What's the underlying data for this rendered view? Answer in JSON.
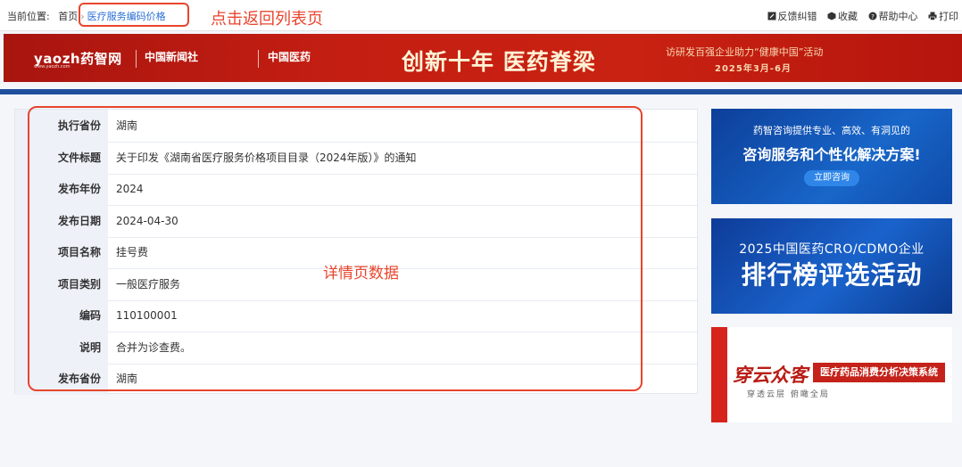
{
  "breadcrumb": {
    "prefix": "当前位置:",
    "home": "首页",
    "separator": "›",
    "current": "医疗服务编码价格"
  },
  "annotations": {
    "back_hint": "点击返回列表页",
    "detail_hint": "详情页数据",
    "color": "#e8452d"
  },
  "tools": {
    "feedback": "反馈纠错",
    "favorite": "收藏",
    "help": "帮助中心",
    "print": "打印"
  },
  "banner": {
    "logo": "yaozh药智网",
    "logo_sub": "www.yaozh.com",
    "partner1": "中国新闻社",
    "partner2": "中国医药",
    "headline": "创新十年 医药脊梁",
    "event": "访研发百强企业助力“健康中国”活动",
    "date": "2025年3月-6月"
  },
  "detail": {
    "rows": [
      {
        "label": "执行省份",
        "value": "湖南"
      },
      {
        "label": "文件标题",
        "value": "关于印发《湖南省医疗服务价格项目目录（2024年版）》的通知"
      },
      {
        "label": "发布年份",
        "value": "2024"
      },
      {
        "label": "发布日期",
        "value": "2024-04-30"
      },
      {
        "label": "项目名称",
        "value": "挂号费"
      },
      {
        "label": "项目类别",
        "value": "一般医疗服务"
      },
      {
        "label": "编码",
        "value": "110100001"
      },
      {
        "label": "说明",
        "value": "合并为诊查费。"
      },
      {
        "label": "发布省份",
        "value": "湖南"
      }
    ]
  },
  "ads": {
    "ad1": {
      "line1": "药智咨询提供专业、高效、有洞见的",
      "line2": "咨询服务和个性化解决方案!",
      "button": "立即咨询"
    },
    "ad2": {
      "line1": "2025中国医药CRO/CDMO企业",
      "line2": "排行榜评选活动"
    },
    "ad3": {
      "brand": "穿云众客",
      "tag": "医疗药品消费分析决策系统",
      "slogan": "穿透云层 俯瞰全局"
    }
  },
  "colors": {
    "link": "#2a6fd6",
    "banner_red": "#c41e12",
    "rule_blue": "#1f4f9c",
    "label_bg": "#eef1f7"
  }
}
